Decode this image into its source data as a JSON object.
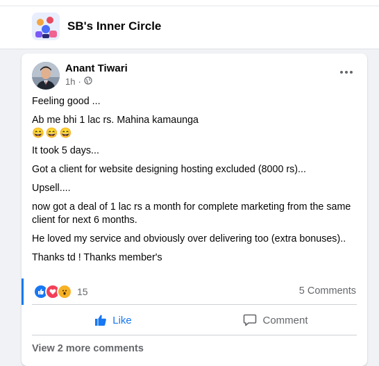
{
  "group": {
    "name": "SB's Inner Circle"
  },
  "post": {
    "author": "Anant Tiwari",
    "time": "1h",
    "separator": "·",
    "paragraphs": [
      "Feeling good ...",
      "Ab me bhi 1 lac rs. Mahina kamaunga",
      "It took 5 days...",
      "Got a client for website designing hosting excluded (8000 rs)...",
      "Upsell....",
      "now got a deal of 1 lac rs a month for complete marketing from the same client for next 6 months.",
      "He loved my service and obviously over delivering too (extra bonuses)..",
      "Thanks td ! Thanks member's"
    ],
    "emojis": [
      "😄",
      "😄",
      "😄"
    ],
    "reaction_count": "15",
    "comments_label": "5 Comments",
    "actions": {
      "like": "Like",
      "comment": "Comment"
    },
    "view_more": "View 2 more comments"
  },
  "colors": {
    "like_blue": "#1877f2",
    "love_red": "#f33e58",
    "wow_yellow": "#f7b125",
    "muted": "#65676b"
  },
  "icons": [
    "group-photo-icon",
    "globe-icon",
    "more-options-icon",
    "like-reaction-icon",
    "love-reaction-icon",
    "wow-reaction-icon",
    "thumbs-up-icon",
    "comment-bubble-icon"
  ]
}
